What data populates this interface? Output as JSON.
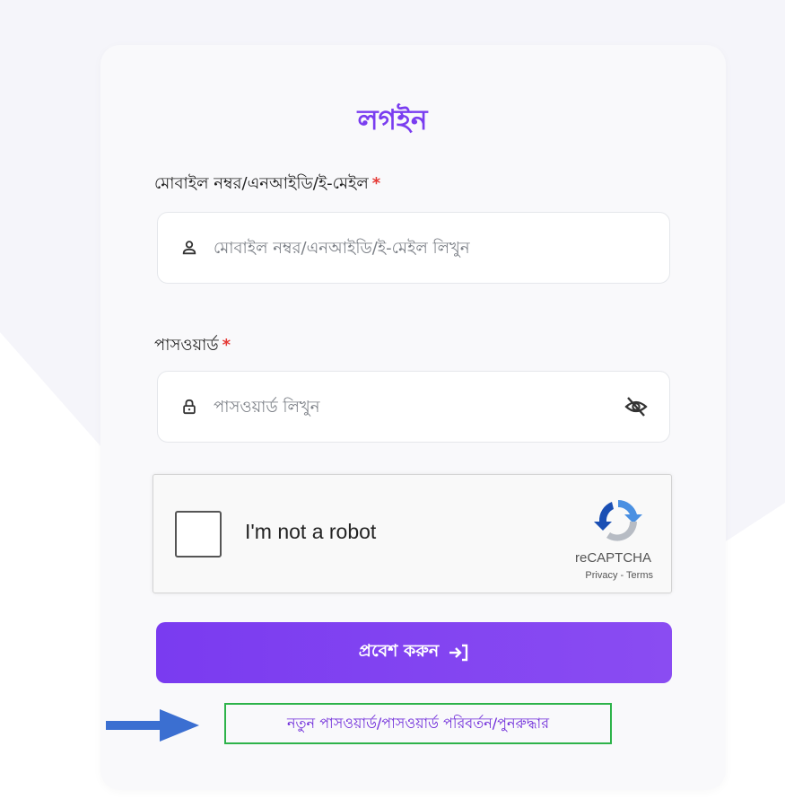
{
  "login": {
    "title": "লগইন",
    "identifier_label": "মোবাইল নম্বর/এনআইডি/ই-মেইল",
    "identifier_placeholder": "মোবাইল নম্বর/এনআইডি/ই-মেইল লিখুন",
    "password_label": "পাসওয়ার্ড",
    "password_placeholder": "পাসওয়ার্ড লিখুন",
    "required_marker": "*",
    "submit_label": "প্রবেশ করুন",
    "reset_link": "নতুন পাসওয়ার্ড/পাসওয়ার্ড পরিবর্তন/পুনরুদ্ধার"
  },
  "recaptcha": {
    "label": "I'm not a robot",
    "brand": "reCAPTCHA",
    "privacy": "Privacy",
    "separator": " - ",
    "terms": "Terms"
  },
  "colors": {
    "accent": "#7a3df0",
    "button": "#7a3bf0",
    "required": "#e53935",
    "annotation_box": "#2db34a",
    "annotation_arrow": "#3b6fd1"
  },
  "icons": {
    "identifier": "user-icon",
    "password": "lock-icon",
    "toggle": "eye-slash-icon",
    "submit": "login-arrow-icon",
    "captcha": "recaptcha-logo-icon"
  }
}
